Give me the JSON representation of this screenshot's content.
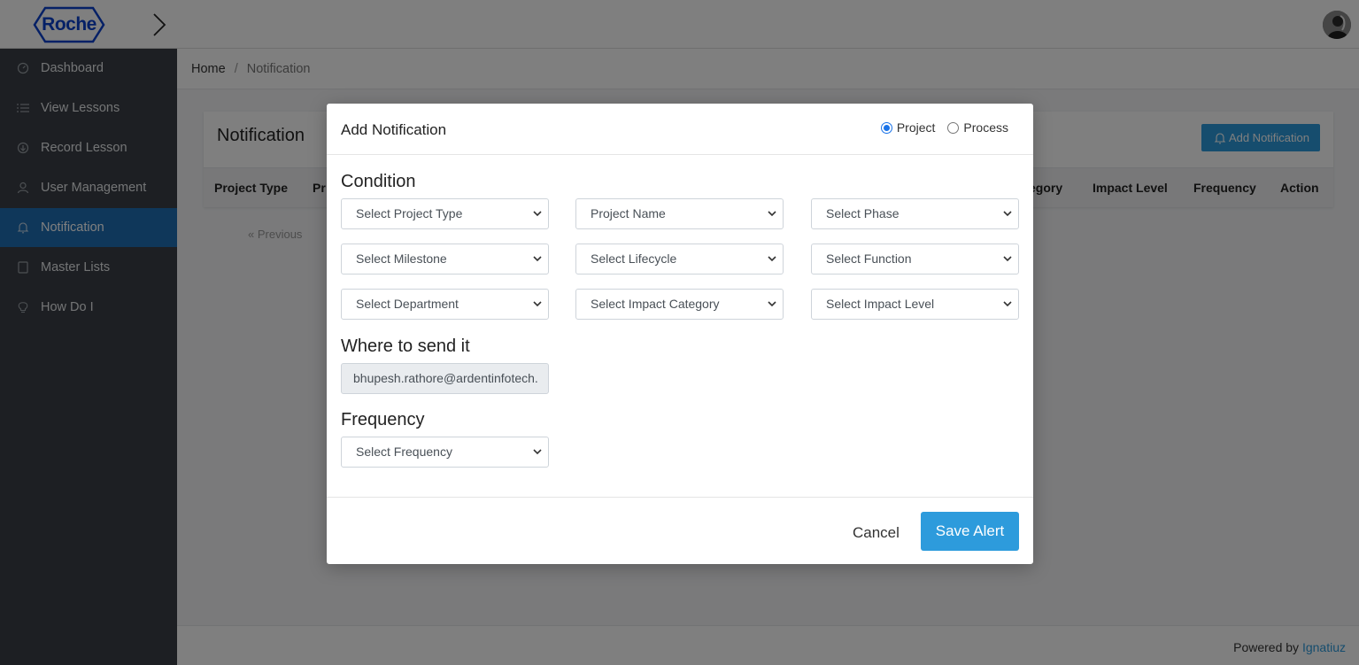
{
  "header": {
    "logo_text": "Roche",
    "avatar_icon": "user-avatar"
  },
  "sidebar": {
    "items": [
      {
        "label": "Dashboard",
        "icon": "dashboard-icon"
      },
      {
        "label": "View Lessons",
        "icon": "list-icon"
      },
      {
        "label": "Record Lesson",
        "icon": "record-icon"
      },
      {
        "label": "User Management",
        "icon": "users-icon"
      },
      {
        "label": "Notification",
        "icon": "bell-icon",
        "active": true
      },
      {
        "label": "Master Lists",
        "icon": "book-icon"
      },
      {
        "label": "How Do I",
        "icon": "lightbulb-icon"
      }
    ]
  },
  "breadcrumb": {
    "home": "Home",
    "separator": "/",
    "current": "Notification"
  },
  "page": {
    "title": "Notification",
    "add_button": "Add Notification",
    "columns": [
      "Project Type",
      "Pr",
      "egory",
      "Impact Level",
      "Frequency",
      "Action"
    ],
    "pager_prev": "« Previous"
  },
  "footer": {
    "prefix": "Powered by",
    "link": "Ignatiuz"
  },
  "modal": {
    "title": "Add Notification",
    "radio_project": "Project",
    "radio_process": "Process",
    "selected_type": "Project",
    "condition_title": "Condition",
    "selects": [
      "Select Project Type",
      "Project Name",
      "Select Phase",
      "Select Milestone",
      "Select Lifecycle",
      "Select Function",
      "Select Department",
      "Select Impact Category",
      "Select Impact Level"
    ],
    "where_title": "Where to send it",
    "email_value": "bhupesh.rathore@ardentinfotech.",
    "frequency_title": "Frequency",
    "frequency_select": "Select Frequency",
    "cancel": "Cancel",
    "save": "Save Alert"
  },
  "colors": {
    "accent": "#2d9bdc",
    "sidebar": "#3a3f47",
    "sidebar_active": "#1f6fb4",
    "logo": "#0b41cd"
  }
}
